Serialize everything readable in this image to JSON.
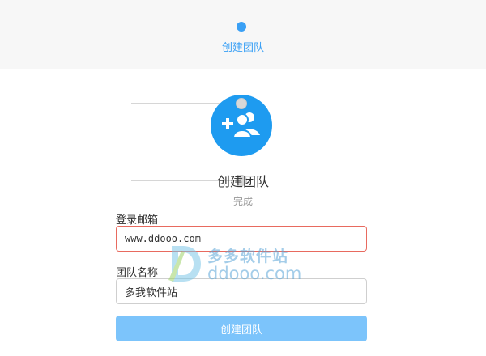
{
  "header": {
    "step_label": "创建团队"
  },
  "progress": {
    "title": "创建团队",
    "subtitle": "完成",
    "icon": "add-team-icon"
  },
  "form": {
    "email_label": "登录邮箱",
    "email_value": "www.ddooo.com",
    "team_label": "团队名称",
    "team_value": "多我软件站",
    "submit_label": "创建团队"
  },
  "watermark": {
    "cn_text": "多多软件站",
    "en_text": "ddooo.com"
  },
  "colors": {
    "accent": "#1e9bf0",
    "button": "#7cc4fb",
    "error_border": "#e86a5f"
  }
}
